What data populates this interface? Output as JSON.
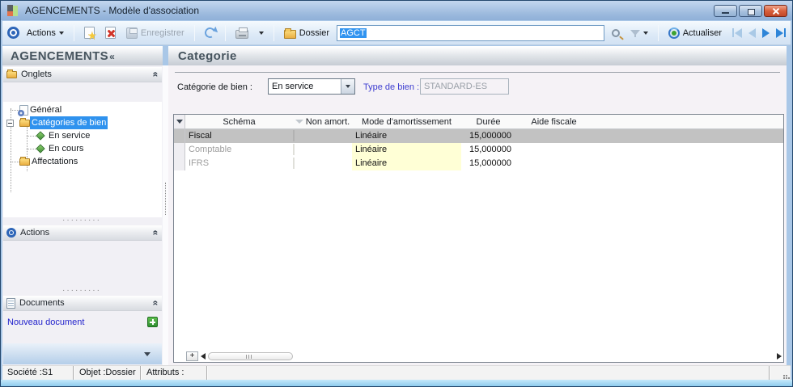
{
  "window": {
    "title": "AGENCEMENTS -  Modèle d'association"
  },
  "toolbar": {
    "actions": "Actions",
    "save": "Enregistrer",
    "dossier": "Dossier",
    "search_value": "AGCT",
    "refresh": "Actualiser"
  },
  "sidebar": {
    "title": "AGENCEMENTS",
    "collapse_glyph": "«",
    "onglets_panel": "Onglets",
    "actions_panel": "Actions",
    "documents_panel": "Documents",
    "tree": {
      "general": "Général",
      "categories": "Catégories de bien",
      "en_service": "En service",
      "en_cours": "En cours",
      "affectations": "Affectations"
    },
    "new_document": "Nouveau document",
    "splitter_dots": "·········"
  },
  "main": {
    "title": "Categorie",
    "form": {
      "category_label": "Catégorie de bien :",
      "category_value": "En service",
      "type_label": "Type de bien :",
      "type_value": "STANDARD-ES"
    },
    "table": {
      "columns": [
        "Schéma",
        "Non amort.",
        "Mode d'amortissement",
        "Durée",
        "Aide fiscale"
      ],
      "rows": [
        {
          "schema": "Fiscal",
          "non_amort": false,
          "mode": "Linéaire",
          "duree": "15,000000",
          "aide_fiscale": "",
          "selected": true
        },
        {
          "schema": "Comptable",
          "non_amort": false,
          "mode": "Linéaire",
          "duree": "15,000000",
          "aide_fiscale": "",
          "selected": false
        },
        {
          "schema": "IFRS",
          "non_amort": false,
          "mode": "Linéaire",
          "duree": "15,000000",
          "aide_fiscale": "",
          "selected": false
        }
      ],
      "add_button": "+"
    }
  },
  "statusbar": {
    "societe": "Société :S1",
    "objet": "Objet :Dossier",
    "attributs": "Attributs :"
  },
  "colors": {
    "selection_blue": "#3194f0",
    "tree_selection": "#2f92ee",
    "row_selected_gray": "#c2c2c2",
    "cell_yellow": "#ffffd6",
    "link_blue": "#2222cc",
    "label_blue": "#3c3cd0"
  }
}
